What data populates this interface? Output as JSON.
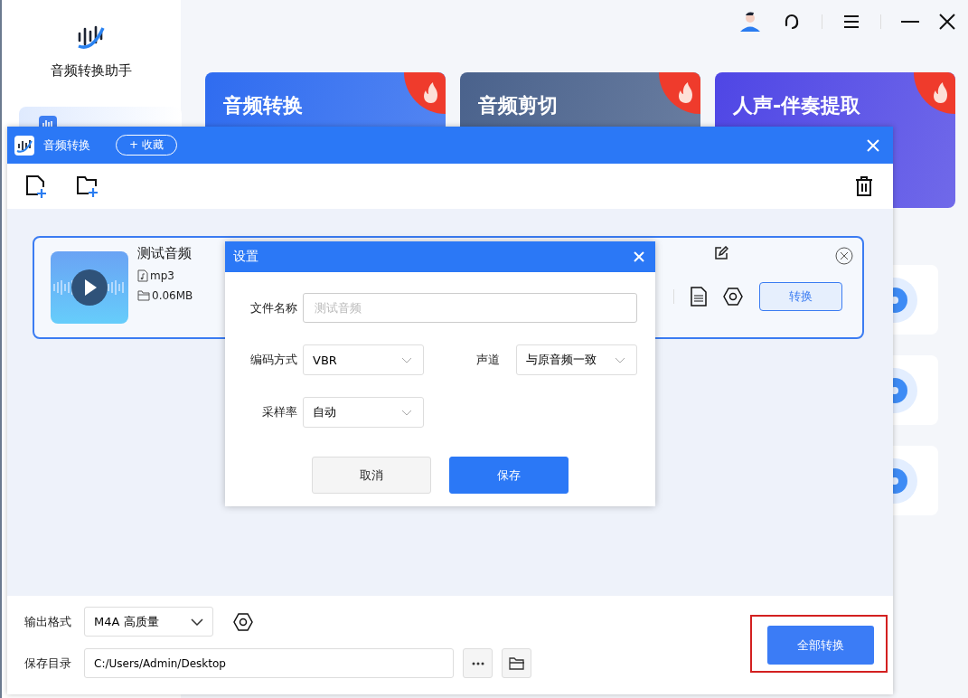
{
  "app": {
    "name": "音频转换助手"
  },
  "feature_cards": [
    {
      "title": "音频转换",
      "color": "#2f6cf0",
      "hot": true
    },
    {
      "title": "音频剪切",
      "color": "#4a628c",
      "hot": true
    },
    {
      "title": "人声-伴奏提取",
      "color": "#4f46e5",
      "hot": true
    }
  ],
  "converter": {
    "title": "音频转换",
    "favorite_button": "+ 收藏",
    "files": [
      {
        "name": "测试音频",
        "format": "mp3",
        "size": "0.06MB",
        "convert_button": "转换"
      }
    ],
    "output_format_label": "输出格式",
    "output_format": "M4A 高质量",
    "save_dir_label": "保存目录",
    "save_dir": "C:/Users/Admin/Desktop",
    "convert_all_button": "全部转换",
    "convert_all_highlighted": true
  },
  "settings_dialog": {
    "title": "设置",
    "fields": [
      {
        "label": "文件名称",
        "kind": "text",
        "placeholder": "测试音频"
      },
      {
        "label": "编码方式",
        "kind": "select",
        "value": "VBR"
      },
      {
        "label": "声道",
        "kind": "select",
        "value": "与原音频一致"
      },
      {
        "label": "采样率",
        "kind": "select",
        "value": "自动"
      }
    ],
    "buttons": [
      {
        "label": "取消",
        "primary": false
      },
      {
        "label": "保存",
        "primary": true
      }
    ]
  }
}
